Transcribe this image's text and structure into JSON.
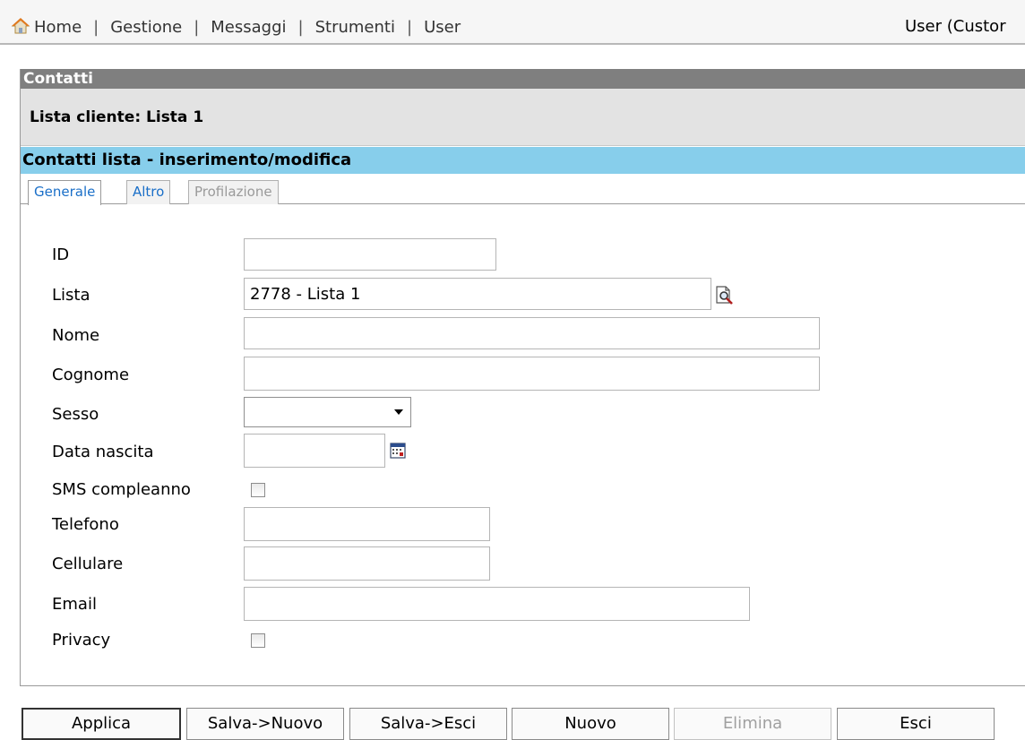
{
  "nav": {
    "items": [
      "Home",
      "Gestione",
      "Messaggi",
      "Strumenti",
      "User"
    ],
    "separator": "|",
    "user_label": "User (Custor"
  },
  "panel": {
    "title": "Contatti",
    "list_title": "Lista cliente: Lista 1",
    "section_title": "Contatti lista - inserimento/modifica",
    "tabs": [
      {
        "label": "Generale",
        "state": "active"
      },
      {
        "label": "Altro",
        "state": "link"
      },
      {
        "label": "Profilazione",
        "state": "disabled"
      }
    ]
  },
  "form": {
    "id": {
      "label": "ID",
      "value": ""
    },
    "lista": {
      "label": "Lista",
      "value": "2778 - Lista 1",
      "icon": "lookup-icon"
    },
    "nome": {
      "label": "Nome",
      "value": ""
    },
    "cognome": {
      "label": "Cognome",
      "value": ""
    },
    "sesso": {
      "label": "Sesso",
      "value": ""
    },
    "data_nascita": {
      "label": "Data nascita",
      "value": "",
      "icon": "calendar-icon"
    },
    "sms_compleanno": {
      "label": "SMS compleanno",
      "checked": false
    },
    "telefono": {
      "label": "Telefono",
      "value": ""
    },
    "cellulare": {
      "label": "Cellulare",
      "value": ""
    },
    "email": {
      "label": "Email",
      "value": ""
    },
    "privacy": {
      "label": "Privacy",
      "checked": false
    }
  },
  "buttons": {
    "applica": "Applica",
    "salva_nuovo": "Salva->Nuovo",
    "salva_esci": "Salva->Esci",
    "nuovo": "Nuovo",
    "elimina": "Elimina",
    "esci": "Esci"
  },
  "colors": {
    "section_bar": "#87ceeb",
    "title_bar": "#7f7f7f",
    "tab_active_text": "#1a6fc8"
  }
}
